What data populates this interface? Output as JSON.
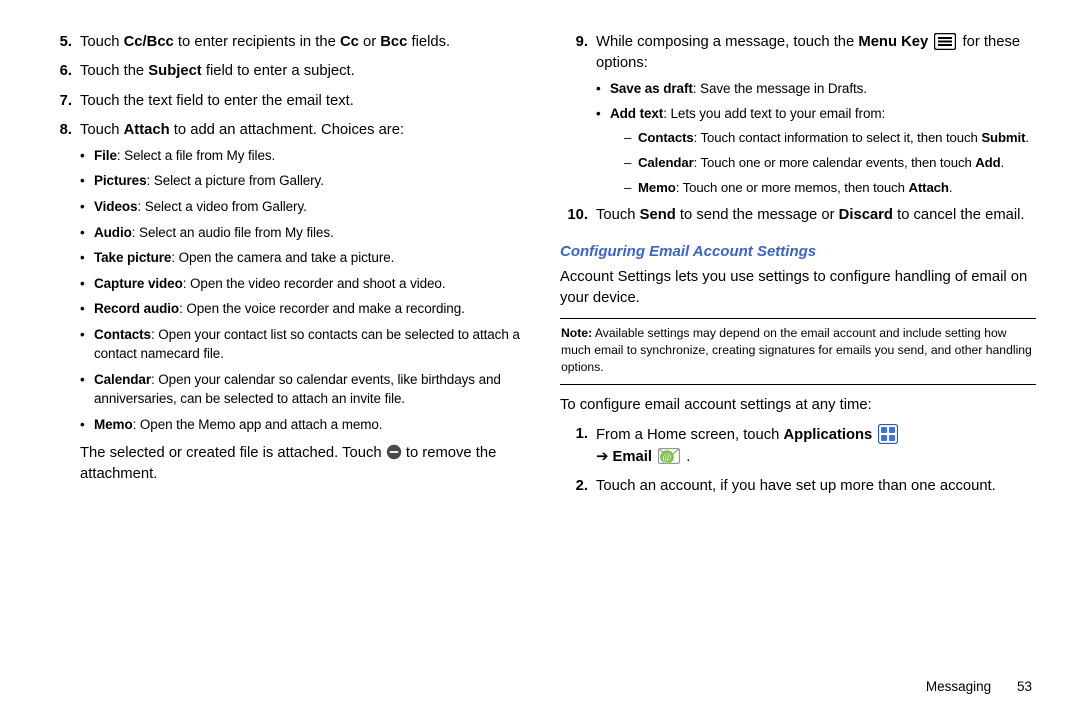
{
  "left": {
    "step5": {
      "pre": "Touch ",
      "b1": "Cc/Bcc",
      "mid": " to enter recipients in the ",
      "b2": "Cc",
      "mid2": " or ",
      "b3": "Bcc",
      "post": " fields."
    },
    "step6": {
      "pre": "Touch the ",
      "b1": "Subject",
      "post": " field to enter a subject."
    },
    "step7": "Touch the text field to enter the email text.",
    "step8": {
      "pre": "Touch ",
      "b1": "Attach",
      "post": " to add an attachment. Choices are:"
    },
    "attach": [
      {
        "b": "File",
        "t": ": Select a file from My files."
      },
      {
        "b": "Pictures",
        "t": ": Select a picture from Gallery."
      },
      {
        "b": "Videos",
        "t": ": Select a video from Gallery."
      },
      {
        "b": "Audio",
        "t": ": Select an audio file from My files."
      },
      {
        "b": "Take picture",
        "t": ": Open the camera and take a picture."
      },
      {
        "b": "Capture video",
        "t": ": Open the video recorder and shoot a video."
      },
      {
        "b": "Record audio",
        "t": ": Open the voice recorder and make a recording."
      },
      {
        "b": "Contacts",
        "t": ": Open your contact list so contacts can be selected to attach a contact namecard file."
      },
      {
        "b": "Calendar",
        "t": ": Open your calendar so calendar events, like birthdays and anniversaries, can be selected to attach an invite file."
      },
      {
        "b": "Memo",
        "t": ": Open the Memo app and attach a memo."
      }
    ],
    "afterAttachA": "The selected or created file is attached. Touch ",
    "afterAttachB": " to remove the attachment."
  },
  "right": {
    "step9": {
      "pre": "While composing a message, touch the ",
      "b1": "Menu Key",
      "post": " for these options:"
    },
    "menu": [
      {
        "b": "Save as draft",
        "t": ": Save the message in Drafts."
      },
      {
        "b": "Add text",
        "t": ": Lets you add text to your email from:"
      }
    ],
    "addtextSub": [
      {
        "b": "Contacts",
        "t": ": Touch contact information to select it, then touch ",
        "b2": "Submit",
        "t2": "."
      },
      {
        "b": "Calendar",
        "t": ": Touch one or more calendar events, then touch ",
        "b2": "Add",
        "t2": "."
      },
      {
        "b": "Memo",
        "t": ": Touch one or more memos, then touch ",
        "b2": "Attach",
        "t2": "."
      }
    ],
    "step10": {
      "pre": "Touch ",
      "b1": "Send",
      "mid": " to send the message or ",
      "b2": "Discard",
      "post": " to cancel the email."
    },
    "sectionHead": "Configuring Email Account Settings",
    "sectionIntro": "Account Settings lets you use settings to configure handling of email on your device.",
    "noteLabel": "Note:",
    "noteBody": "Available settings may depend on the email account and include setting how much email to synchronize, creating signatures for emails you send, and other handling options.",
    "configLead": "To configure email account settings at any time:",
    "cfg1a": "From a Home screen, touch ",
    "cfg1b": "Applications",
    "cfg1c": " ",
    "cfg1arrow": "➔",
    "cfg1d": " Email",
    "cfg1e": " .",
    "cfg2": "Touch an account, if you have set up more than one account."
  },
  "footer": {
    "section": "Messaging",
    "page": "53"
  }
}
